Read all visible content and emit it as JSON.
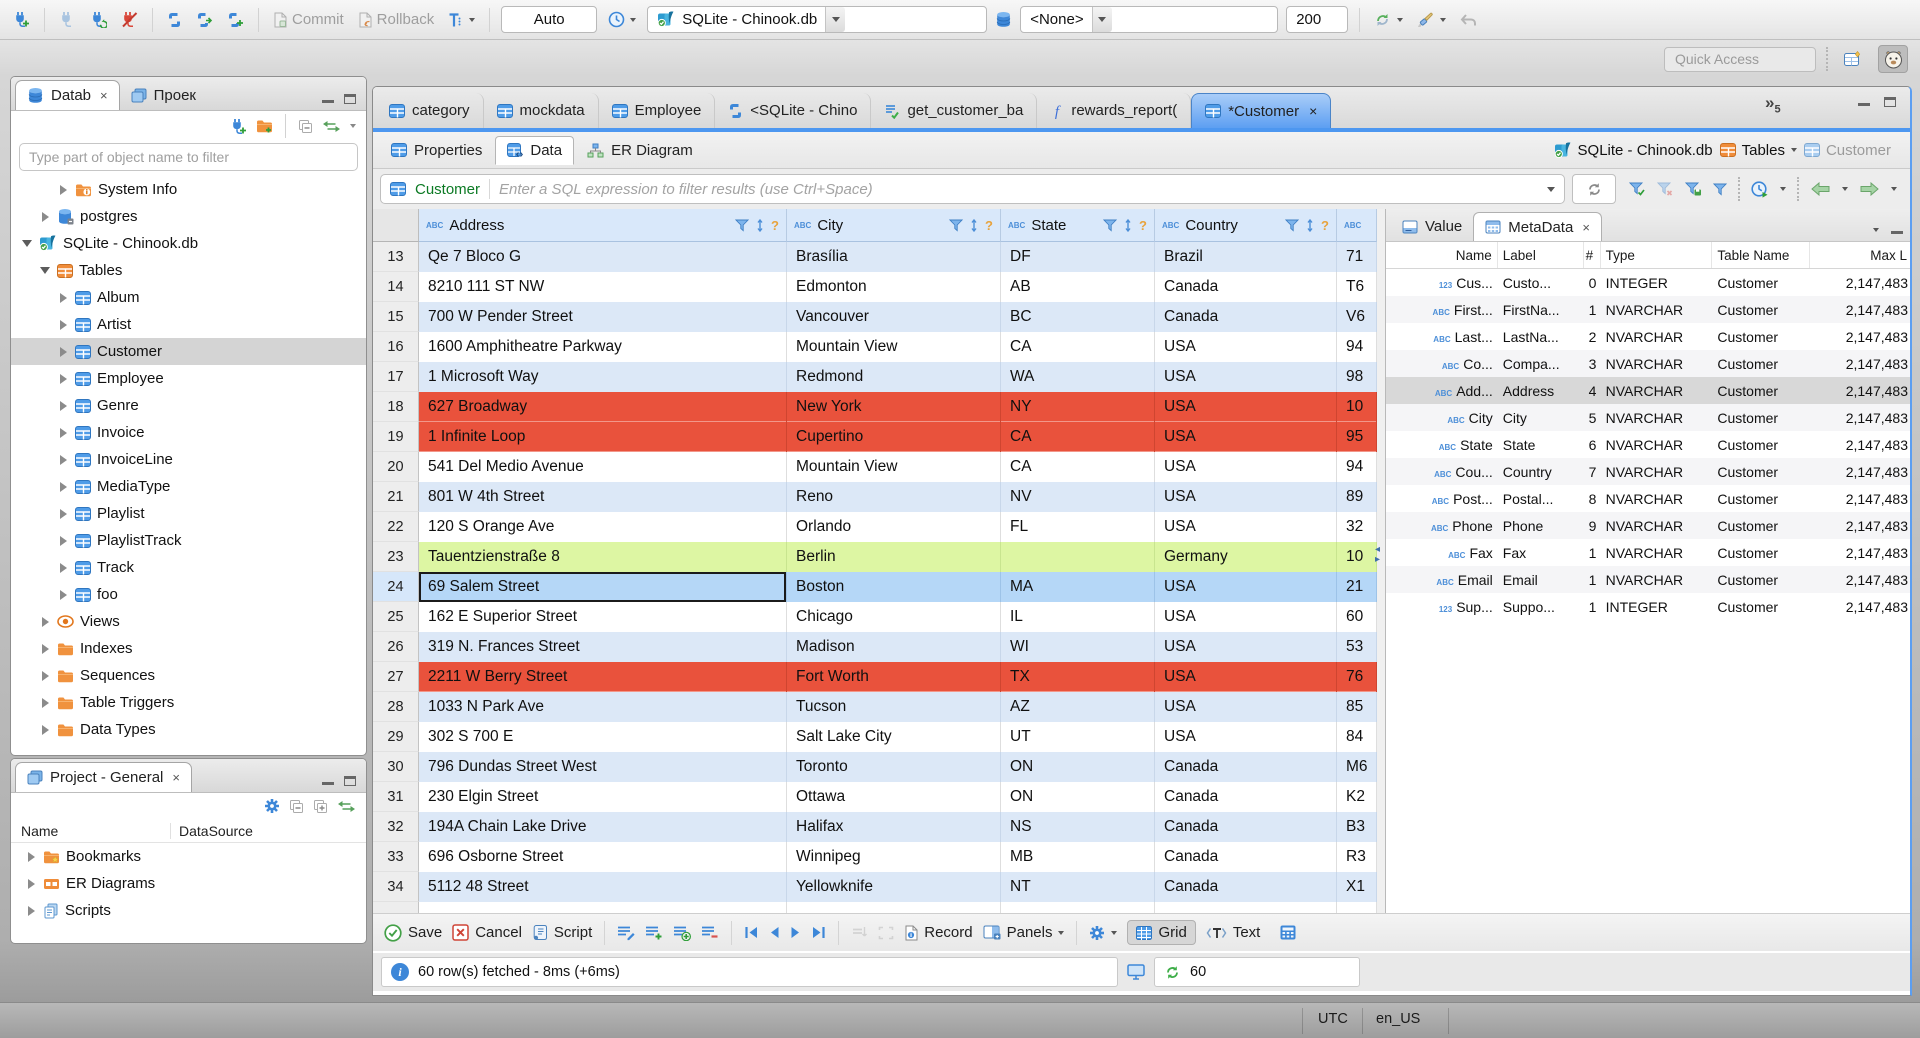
{
  "theme": {
    "accent": "#4d97f0",
    "row_red": "#e9523c",
    "row_green": "#ddf6a3",
    "row_alt": "#dce8f7",
    "row_selected": "#b5d7f7",
    "grid_header_bg": "#d9e8fa"
  },
  "toolbar": {
    "commit_label": "Commit",
    "rollback_label": "Rollback",
    "txn_mode": "Auto",
    "connection": "SQLite - Chinook.db",
    "database": "<None>",
    "fetch_size": "200",
    "quick_access_placeholder": "Quick Access"
  },
  "navigator": {
    "tab_database": "Datab",
    "tab_project": "Проек",
    "filter_placeholder": "Type part of object name to filter",
    "items": [
      {
        "label": "System Info",
        "icon": "folder-info",
        "ind": 2,
        "ar": "r"
      },
      {
        "label": "postgres",
        "icon": "db-tool",
        "ind": 1,
        "ar": "r"
      },
      {
        "label": "SQLite - Chinook.db",
        "icon": "sqlite",
        "ind": 0,
        "ar": "d"
      },
      {
        "label": "Tables",
        "icon": "tables-folder",
        "ind": 1,
        "ar": "d"
      },
      {
        "label": "Album",
        "icon": "table",
        "ind": 2,
        "ar": "r"
      },
      {
        "label": "Artist",
        "icon": "table",
        "ind": 2,
        "ar": "r"
      },
      {
        "label": "Customer",
        "icon": "table",
        "ind": 2,
        "ar": "r",
        "cls": "selected"
      },
      {
        "label": "Employee",
        "icon": "table",
        "ind": 2,
        "ar": "r"
      },
      {
        "label": "Genre",
        "icon": "table",
        "ind": 2,
        "ar": "r"
      },
      {
        "label": "Invoice",
        "icon": "table",
        "ind": 2,
        "ar": "r"
      },
      {
        "label": "InvoiceLine",
        "icon": "table",
        "ind": 2,
        "ar": "r"
      },
      {
        "label": "MediaType",
        "icon": "table",
        "ind": 2,
        "ar": "r"
      },
      {
        "label": "Playlist",
        "icon": "table",
        "ind": 2,
        "ar": "r"
      },
      {
        "label": "PlaylistTrack",
        "icon": "table",
        "ind": 2,
        "ar": "r"
      },
      {
        "label": "Track",
        "icon": "table",
        "ind": 2,
        "ar": "r"
      },
      {
        "label": "foo",
        "icon": "table",
        "ind": 2,
        "ar": "r"
      },
      {
        "label": "Views",
        "icon": "views",
        "ind": 1,
        "ar": "r"
      },
      {
        "label": "Indexes",
        "icon": "folder",
        "ind": 1,
        "ar": "r"
      },
      {
        "label": "Sequences",
        "icon": "folder",
        "ind": 1,
        "ar": "r"
      },
      {
        "label": "Table Triggers",
        "icon": "folder",
        "ind": 1,
        "ar": "r"
      },
      {
        "label": "Data Types",
        "icon": "folder",
        "ind": 1,
        "ar": "r"
      }
    ]
  },
  "project_panel": {
    "title": "Project - General",
    "col_name": "Name",
    "col_datasource": "DataSource",
    "items": [
      {
        "label": "Bookmarks",
        "icon": "folder-star",
        "ar": "r"
      },
      {
        "label": "ER Diagrams",
        "icon": "er",
        "ar": "r"
      },
      {
        "label": "Scripts",
        "icon": "scripts",
        "ar": "r"
      }
    ]
  },
  "editor": {
    "tabs": [
      {
        "label": "category",
        "icon": "table"
      },
      {
        "label": "mockdata",
        "icon": "table"
      },
      {
        "label": "Employee",
        "icon": "table"
      },
      {
        "label": "<SQLite - Chino",
        "icon": "sql-tab"
      },
      {
        "label": "get_customer_ba",
        "icon": "script-check"
      },
      {
        "label": "rewards_report(",
        "icon": "func"
      },
      {
        "label": "*Customer",
        "icon": "table",
        "cls": "active",
        "closable": true
      }
    ],
    "overflow_count": "5",
    "subtabs": [
      {
        "label": "Properties",
        "icon": "table"
      },
      {
        "label": "Data",
        "icon": "table-edit",
        "cls": "active"
      },
      {
        "label": "ER Diagram",
        "icon": "er-nodes"
      }
    ],
    "breadcrumb": [
      {
        "label": "SQLite - Chinook.db",
        "icon": "sqlite"
      },
      {
        "label": "Tables",
        "icon": "tables-folder",
        "dropdown": true
      },
      {
        "label": "Customer",
        "icon": "table-light",
        "cls": "muted"
      }
    ]
  },
  "filterbar": {
    "entity": "Customer",
    "placeholder": "Enter a SQL expression to filter results (use Ctrl+Space)"
  },
  "grid": {
    "columns": {
      "address": "Address",
      "city": "City",
      "state": "State",
      "country": "Country"
    },
    "rows": [
      {
        "num": "13",
        "address": "Qe 7 Bloco G",
        "city": "Brasília",
        "state": "DF",
        "country": "Brazil",
        "postal": "71",
        "cls": "alt"
      },
      {
        "num": "14",
        "address": "8210 111 ST NW",
        "city": "Edmonton",
        "state": "AB",
        "country": "Canada",
        "postal": "T6"
      },
      {
        "num": "15",
        "address": "700 W Pender Street",
        "city": "Vancouver",
        "state": "BC",
        "country": "Canada",
        "postal": "V6",
        "cls": "alt"
      },
      {
        "num": "16",
        "address": "1600 Amphitheatre Parkway",
        "city": "Mountain View",
        "state": "CA",
        "country": "USA",
        "postal": "94"
      },
      {
        "num": "17",
        "address": "1 Microsoft Way",
        "city": "Redmond",
        "state": "WA",
        "country": "USA",
        "postal": "98",
        "cls": "alt"
      },
      {
        "num": "18",
        "address": "627 Broadway",
        "city": "New York",
        "state": "NY",
        "country": "USA",
        "postal": "10",
        "cls": "red"
      },
      {
        "num": "19",
        "address": "1 Infinite Loop",
        "city": "Cupertino",
        "state": "CA",
        "country": "USA",
        "postal": "95",
        "cls": "red"
      },
      {
        "num": "20",
        "address": "541 Del Medio Avenue",
        "city": "Mountain View",
        "state": "CA",
        "country": "USA",
        "postal": "94"
      },
      {
        "num": "21",
        "address": "801 W 4th Street",
        "city": "Reno",
        "state": "NV",
        "country": "USA",
        "postal": "89",
        "cls": "alt"
      },
      {
        "num": "22",
        "address": "120 S Orange Ave",
        "city": "Orlando",
        "state": "FL",
        "country": "USA",
        "postal": "32"
      },
      {
        "num": "23",
        "address": "Tauentzienstraße 8",
        "city": "Berlin",
        "state": "",
        "country": "Germany",
        "postal": "10",
        "cls": "green"
      },
      {
        "num": "24",
        "address": "69 Salem Street",
        "city": "Boston",
        "state": "MA",
        "country": "USA",
        "postal": "21",
        "cls": "sel"
      },
      {
        "num": "25",
        "address": "162 E Superior Street",
        "city": "Chicago",
        "state": "IL",
        "country": "USA",
        "postal": "60"
      },
      {
        "num": "26",
        "address": "319 N. Frances Street",
        "city": "Madison",
        "state": "WI",
        "country": "USA",
        "postal": "53",
        "cls": "alt"
      },
      {
        "num": "27",
        "address": "2211 W Berry Street",
        "city": "Fort Worth",
        "state": "TX",
        "country": "USA",
        "postal": "76",
        "cls": "red"
      },
      {
        "num": "28",
        "address": "1033 N Park Ave",
        "city": "Tucson",
        "state": "AZ",
        "country": "USA",
        "postal": "85",
        "cls": "alt"
      },
      {
        "num": "29",
        "address": "302 S 700 E",
        "city": "Salt Lake City",
        "state": "UT",
        "country": "USA",
        "postal": "84"
      },
      {
        "num": "30",
        "address": "796 Dundas Street West",
        "city": "Toronto",
        "state": "ON",
        "country": "Canada",
        "postal": "M6",
        "cls": "alt"
      },
      {
        "num": "31",
        "address": "230 Elgin Street",
        "city": "Ottawa",
        "state": "ON",
        "country": "Canada",
        "postal": "K2"
      },
      {
        "num": "32",
        "address": "194A Chain Lake Drive",
        "city": "Halifax",
        "state": "NS",
        "country": "Canada",
        "postal": "B3",
        "cls": "alt"
      },
      {
        "num": "33",
        "address": "696 Osborne Street",
        "city": "Winnipeg",
        "state": "MB",
        "country": "Canada",
        "postal": "R3"
      },
      {
        "num": "34",
        "address": "5112 48 Street",
        "city": "Yellowknife",
        "state": "NT",
        "country": "Canada",
        "postal": "X1",
        "cls": "alt"
      }
    ]
  },
  "meta": {
    "tab_value": "Value",
    "tab_metadata": "MetaData",
    "columns": {
      "name": "Name",
      "label": "Label",
      "num": "#",
      "type": "Type",
      "table": "Table Name",
      "max": "Max L"
    },
    "rows": [
      {
        "icon": "mini-123",
        "name": "Cus...",
        "label": "Custo...",
        "num": "0",
        "type": "INTEGER",
        "table": "Customer",
        "max": "2,147,483"
      },
      {
        "icon": "mini-abc",
        "name": "First...",
        "label": "FirstNa...",
        "num": "1",
        "type": "NVARCHAR",
        "table": "Customer",
        "max": "2,147,483",
        "cls": "lt"
      },
      {
        "icon": "mini-abc",
        "name": "Last...",
        "label": "LastNa...",
        "num": "2",
        "type": "NVARCHAR",
        "table": "Customer",
        "max": "2,147,483"
      },
      {
        "icon": "mini-abc",
        "name": "Co...",
        "label": "Compa...",
        "num": "3",
        "type": "NVARCHAR",
        "table": "Customer",
        "max": "2,147,483",
        "cls": "lt"
      },
      {
        "icon": "mini-abc",
        "name": "Add...",
        "label": "Address",
        "num": "4",
        "type": "NVARCHAR",
        "table": "Customer",
        "max": "2,147,483",
        "cls": "sel"
      },
      {
        "icon": "mini-abc",
        "name": "City",
        "label": "City",
        "num": "5",
        "type": "NVARCHAR",
        "table": "Customer",
        "max": "2,147,483",
        "cls": "lt"
      },
      {
        "icon": "mini-abc",
        "name": "State",
        "label": "State",
        "num": "6",
        "type": "NVARCHAR",
        "table": "Customer",
        "max": "2,147,483"
      },
      {
        "icon": "mini-abc",
        "name": "Cou...",
        "label": "Country",
        "num": "7",
        "type": "NVARCHAR",
        "table": "Customer",
        "max": "2,147,483",
        "cls": "lt"
      },
      {
        "icon": "mini-abc",
        "name": "Post...",
        "label": "Postal...",
        "num": "8",
        "type": "NVARCHAR",
        "table": "Customer",
        "max": "2,147,483"
      },
      {
        "icon": "mini-abc",
        "name": "Phone",
        "label": "Phone",
        "num": "9",
        "type": "NVARCHAR",
        "table": "Customer",
        "max": "2,147,483",
        "cls": "lt"
      },
      {
        "icon": "mini-abc",
        "name": "Fax",
        "label": "Fax",
        "num": "1",
        "type": "NVARCHAR",
        "table": "Customer",
        "max": "2,147,483"
      },
      {
        "icon": "mini-abc",
        "name": "Email",
        "label": "Email",
        "num": "1",
        "type": "NVARCHAR",
        "table": "Customer",
        "max": "2,147,483",
        "cls": "lt"
      },
      {
        "icon": "mini-123",
        "name": "Sup...",
        "label": "Suppo...",
        "num": "1",
        "type": "INTEGER",
        "table": "Customer",
        "max": "2,147,483"
      }
    ]
  },
  "results_toolbar": {
    "save": "Save",
    "cancel": "Cancel",
    "script": "Script",
    "record": "Record",
    "panels": "Panels",
    "grid": "Grid",
    "text": "Text"
  },
  "statusbar": {
    "message": "60 row(s) fetched - 8ms (+6ms)",
    "autorefresh_count": "60"
  },
  "app_statusbar": {
    "timezone": "UTC",
    "locale": "en_US"
  }
}
